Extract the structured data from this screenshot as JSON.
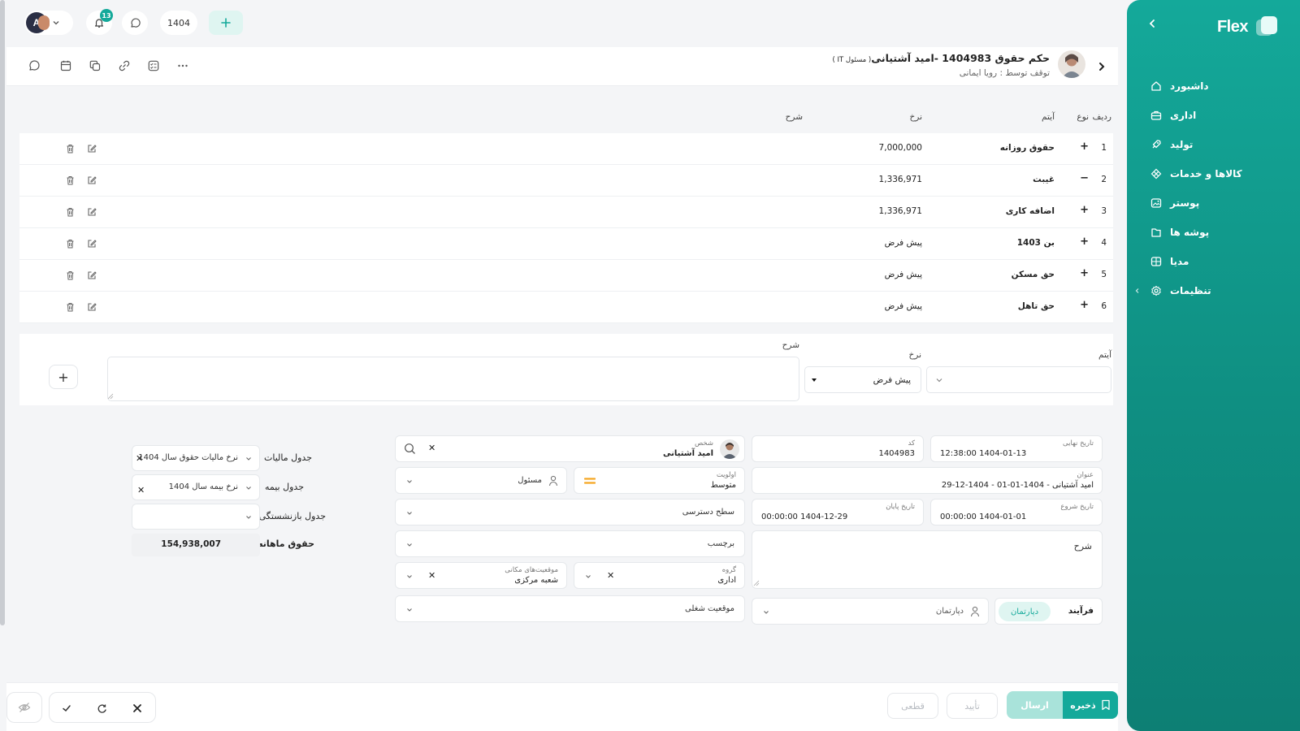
{
  "sidebar": {
    "brand": "Flex",
    "items": [
      {
        "label": "داشبورد",
        "icon": "home-icon"
      },
      {
        "label": "اداری",
        "icon": "briefcase-icon"
      },
      {
        "label": "تولید",
        "icon": "rocket-icon"
      },
      {
        "label": "کالاها و خدمات",
        "icon": "grid-diamond-icon"
      },
      {
        "label": "پوستر",
        "icon": "image-icon"
      },
      {
        "label": "پوشه ها",
        "icon": "folder-icon"
      },
      {
        "label": "مدیا",
        "icon": "media-icon"
      },
      {
        "label": "تنظیمات",
        "icon": "gear-icon"
      }
    ]
  },
  "topbar": {
    "notification_count": "13",
    "year": "1404",
    "avatar_initial": "A"
  },
  "titlebar": {
    "title": "حکم حقوق 1404983 -امید آشتیانی",
    "title_suffix": "( مسئول IT )",
    "subtitle": "توقف توسط : رویا ایمانی"
  },
  "table": {
    "headers": {
      "row": "ردیف",
      "type": "نوع",
      "item": "آیتم",
      "rate": "نرخ",
      "desc": "شرح"
    },
    "rows": [
      {
        "no": "1",
        "sign": "+",
        "item": "حقوق روزانه",
        "rate": "7,000,000"
      },
      {
        "no": "2",
        "sign": "−",
        "item": "غیبت",
        "rate": "1,336,971"
      },
      {
        "no": "3",
        "sign": "+",
        "item": "اضافه کاری",
        "rate": "1,336,971"
      },
      {
        "no": "4",
        "sign": "+",
        "item": "بن 1403",
        "rate": "پیش فرض"
      },
      {
        "no": "5",
        "sign": "+",
        "item": "حق مسکن",
        "rate": "پیش فرض"
      },
      {
        "no": "6",
        "sign": "+",
        "item": "حق تاهل",
        "rate": "پیش فرض"
      }
    ]
  },
  "additem": {
    "item_label": "آیتم",
    "rate_label": "نرخ",
    "rate_value": "پیش فرض",
    "desc_label": "شرح",
    "add": "+"
  },
  "form": {
    "final_date_label": "تاریخ نهایی",
    "final_date": "1404-01-13 12:38:00",
    "code_label": "کد",
    "code": "1404983",
    "person_label": "شخص",
    "person": "امید آشتیانی",
    "subject_label": "عنوان",
    "subject": "امید آشتیانی - 1404-01-01  -  1404-12-29",
    "priority_label": "اولویت",
    "priority": "متوسط",
    "responsible": "مسئول",
    "start_label": "تاریخ شروع",
    "start": "1404-01-01 00:00:00",
    "end_label": "تاریخ پایان",
    "end": "1404-12-29 00:00:00",
    "access": "سطح دسترسی",
    "desc_label": "شرح",
    "tag": "برچسب",
    "group_label": "گروه",
    "group": "اداری",
    "location_label": "موقعیت‌های مکانی",
    "location": "شعبه مرکزی",
    "process_tab": "فرآیند",
    "department_tab": "دپارتمان",
    "department": "دپارتمان",
    "job_position": "موقعیت شغلی"
  },
  "tables_side": {
    "tax_label": "جدول مالیات",
    "tax_value": "نرخ مالیات حقوق سال 1404",
    "insurance_label": "جدول بیمه",
    "insurance_value": "نرخ بیمه سال 1404",
    "retire_label": "جدول بازنشستگی",
    "salary_label": "حقوق ماهانه",
    "salary_value": "154,938,007"
  },
  "bottombar": {
    "save": "ذخیره",
    "send": "ارسال",
    "confirm": "تأیید",
    "final": "قطعی"
  },
  "colors": {
    "accent": "#14a99a",
    "accent_light": "#bfece5",
    "badge": "#14a99a",
    "priority": "#f5a623"
  }
}
